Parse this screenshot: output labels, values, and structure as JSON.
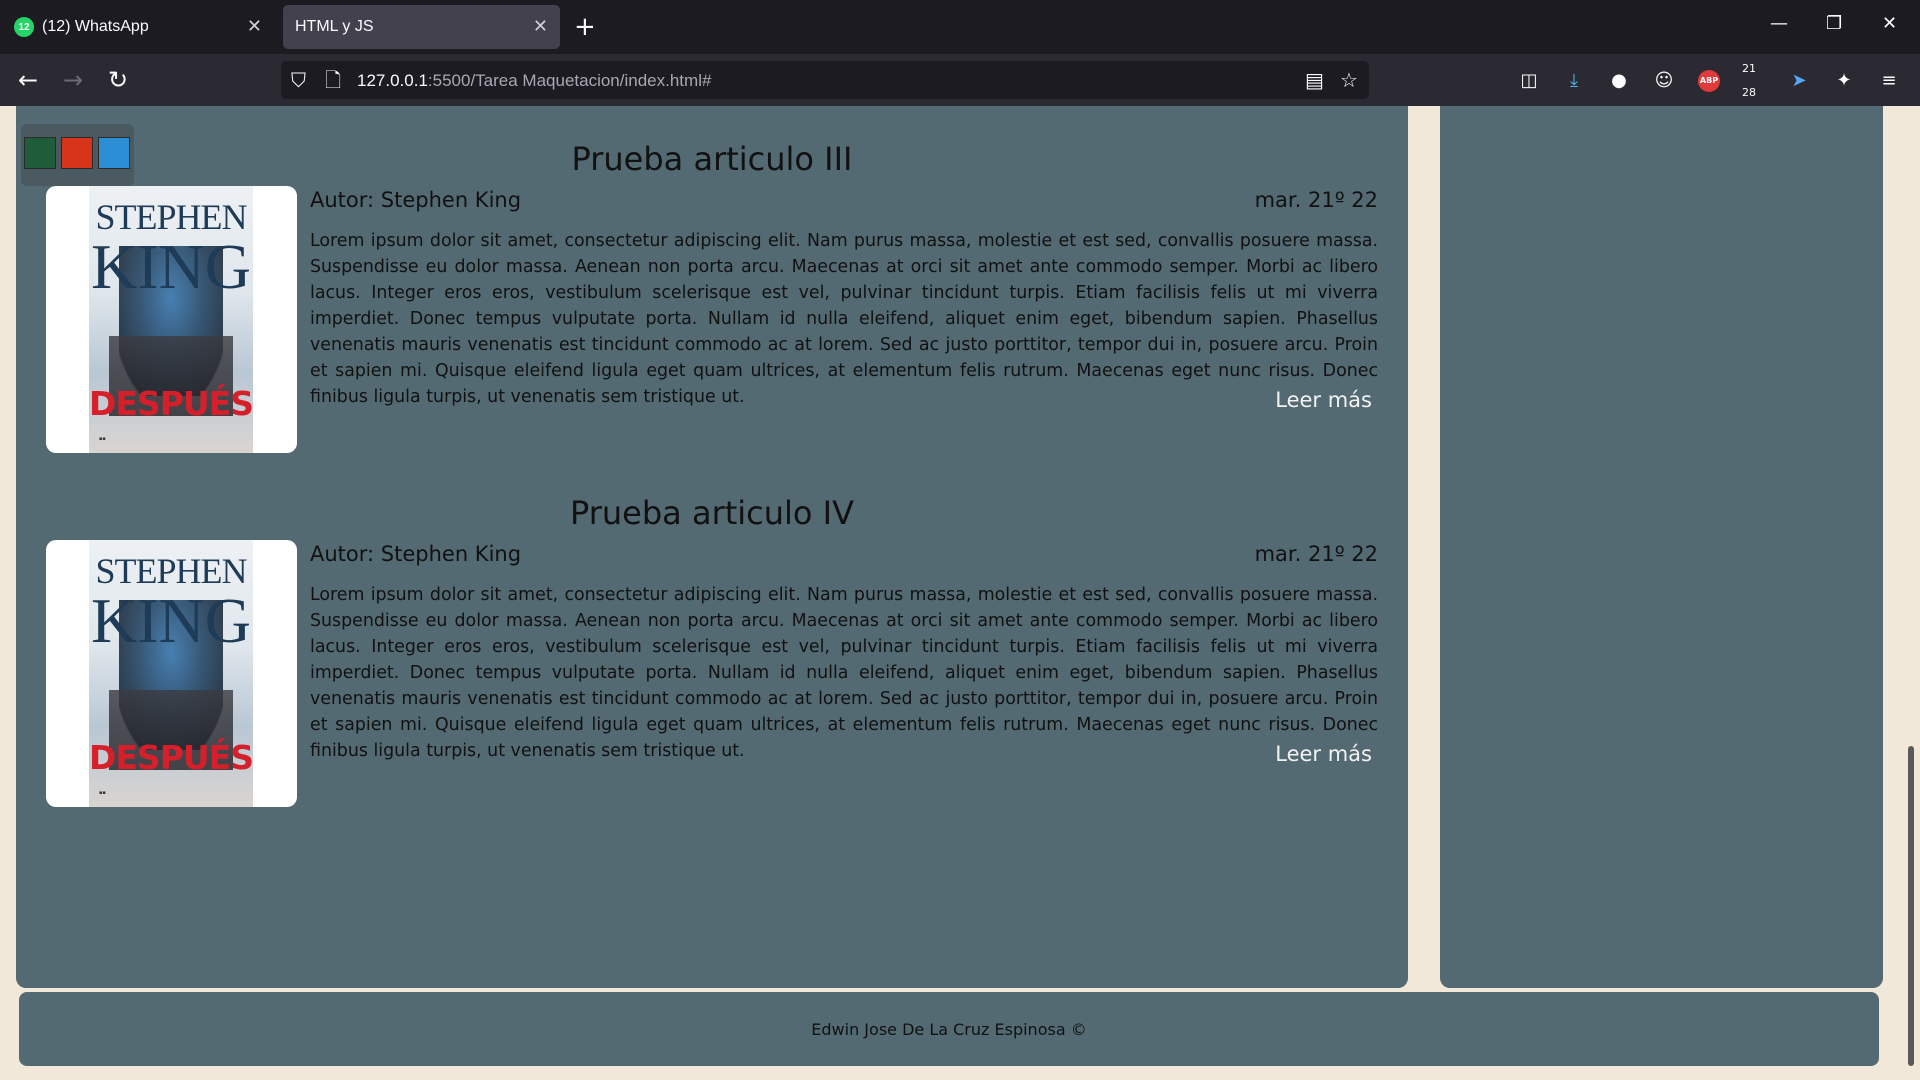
{
  "browser": {
    "tabs": [
      {
        "title": "(12) WhatsApp",
        "badge": "12"
      },
      {
        "title": "HTML y JS"
      }
    ],
    "url_host": "127.0.0.1",
    "url_rest": ":5500/Tarea Maquetacion/index.html#",
    "extension_counter": "21 28"
  },
  "theme_swatches": [
    "#1e5c3a",
    "#d7341a",
    "#2c8fd6"
  ],
  "articles": [
    {
      "title": "Prueba articulo III",
      "author": "Autor: Stephen King",
      "date": "mar. 21º 22",
      "cover_author_line1": "STEPHEN",
      "cover_author_line2": "KING",
      "cover_title": "DESPUÉS",
      "body": "Lorem ipsum dolor sit amet, consectetur adipiscing elit. Nam purus massa, molestie et est sed, convallis posuere massa. Suspendisse eu dolor massa. Aenean non porta arcu. Maecenas at orci sit amet ante commodo semper. Morbi ac libero lacus. Integer eros eros, vestibulum scelerisque est vel, pulvinar tincidunt turpis. Etiam facilisis felis ut mi viverra imperdiet. Donec tempus vulputate porta. Nullam id nulla eleifend, aliquet enim eget, bibendum sapien. Phasellus venenatis mauris venenatis est tincidunt commodo ac at lorem. Sed ac justo porttitor, tempor dui in, posuere arcu. Proin et sapien mi. Quisque eleifend ligula eget quam ultrices, at elementum felis rutrum. Maecenas eget nunc risus. Donec finibus ligula turpis, ut venenatis sem tristique ut.",
      "read_more": "Leer más"
    },
    {
      "title": "Prueba articulo IV",
      "author": "Autor: Stephen King",
      "date": "mar. 21º 22",
      "cover_author_line1": "STEPHEN",
      "cover_author_line2": "KING",
      "cover_title": "DESPUÉS",
      "body": "Lorem ipsum dolor sit amet, consectetur adipiscing elit. Nam purus massa, molestie et est sed, convallis posuere massa. Suspendisse eu dolor massa. Aenean non porta arcu. Maecenas at orci sit amet ante commodo semper. Morbi ac libero lacus. Integer eros eros, vestibulum scelerisque est vel, pulvinar tincidunt turpis. Etiam facilisis felis ut mi viverra imperdiet. Donec tempus vulputate porta. Nullam id nulla eleifend, aliquet enim eget, bibendum sapien. Phasellus venenatis mauris venenatis est tincidunt commodo ac at lorem. Sed ac justo porttitor, tempor dui in, posuere arcu. Proin et sapien mi. Quisque eleifend ligula eget quam ultrices, at elementum felis rutrum. Maecenas eget nunc risus. Donec finibus ligula turpis, ut venenatis sem tristique ut.",
      "read_more": "Leer más"
    }
  ],
  "footer": {
    "text": "Edwin Jose De La Cruz Espinosa ©"
  },
  "colors": {
    "panel": "#546a73",
    "page_bg": "#f2e8da",
    "chrome_dark": "#1c1b22"
  }
}
